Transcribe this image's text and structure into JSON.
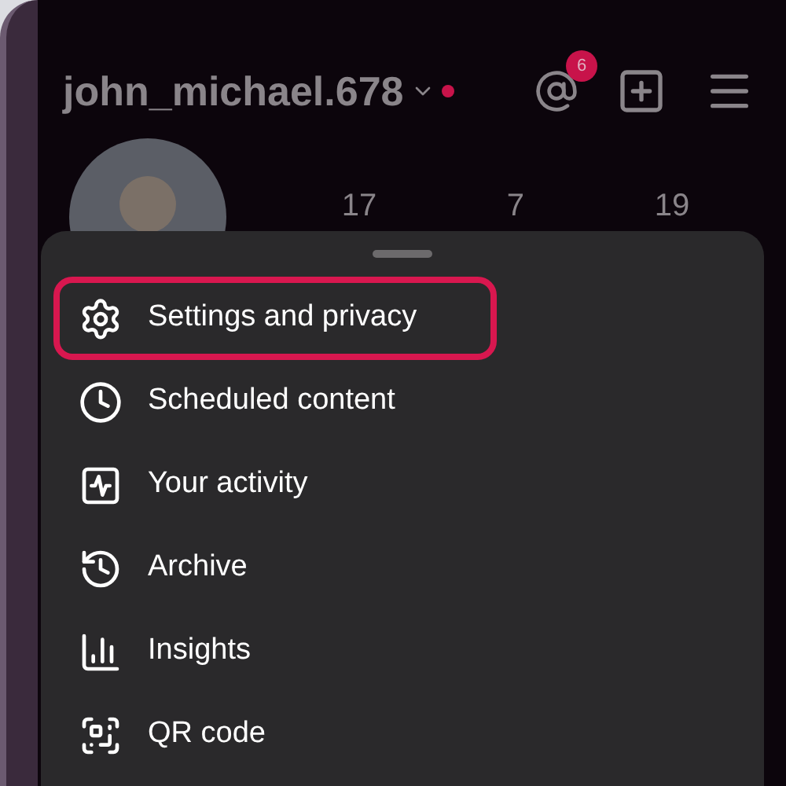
{
  "header": {
    "username": "john_michael.678",
    "notification_badge": "6"
  },
  "stats": [
    "17",
    "7",
    "19"
  ],
  "menu": [
    {
      "label": "Settings and privacy",
      "selected": true
    },
    {
      "label": "Scheduled content",
      "selected": false
    },
    {
      "label": "Your activity",
      "selected": false
    },
    {
      "label": "Archive",
      "selected": false
    },
    {
      "label": "Insights",
      "selected": false
    },
    {
      "label": "QR code",
      "selected": false
    }
  ]
}
